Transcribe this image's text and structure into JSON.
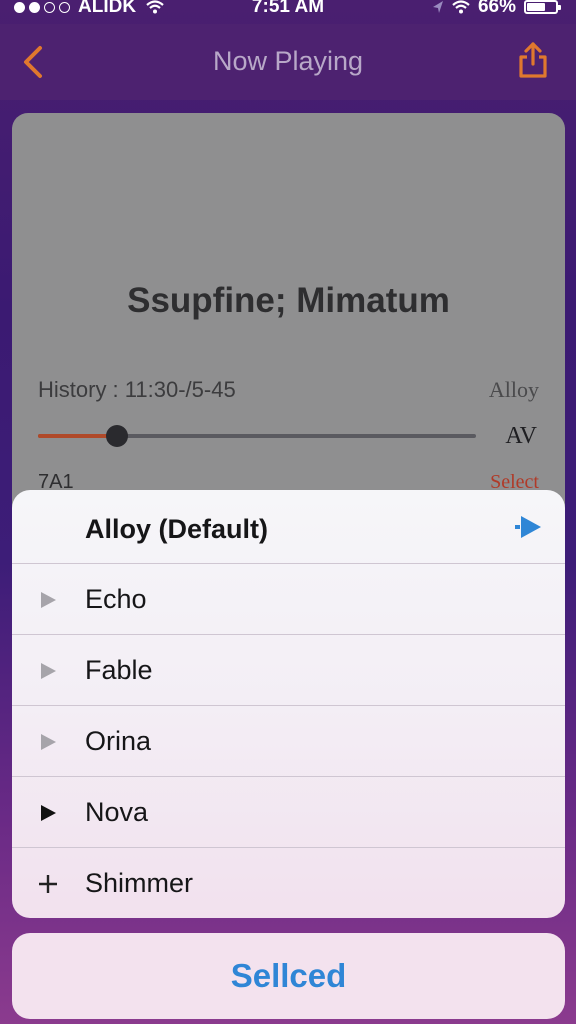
{
  "status_bar": {
    "carrier": "ALIDK",
    "time": "7:51 AM",
    "battery": "66%",
    "battery_level": 0.66,
    "icons": [
      "signal-dots-icon",
      "wifi-icon",
      "location-arrow-icon",
      "battery-icon"
    ]
  },
  "nav": {
    "title": "Now Playing",
    "back_icon": "chevron-left-icon",
    "share_icon": "share-icon",
    "accent": "#e0782e"
  },
  "card": {
    "title": "Ssupfine; Mimatum",
    "history": "History : 11:30-/5-45",
    "voice_label": "Alloy",
    "progress": 0.18,
    "av_label": "AV",
    "code_label": "7A1",
    "select_label": "Select"
  },
  "menu": {
    "options": [
      {
        "label": "Alloy (Default)",
        "marker": "none",
        "selected": true,
        "play_icon": "play-icon",
        "play_color": "#2f86d6"
      },
      {
        "label": "Echo",
        "marker": "triangle-light"
      },
      {
        "label": "Fable",
        "marker": "triangle-light"
      },
      {
        "label": "Orina",
        "marker": "triangle-light"
      },
      {
        "label": "Nova",
        "marker": "triangle-dark"
      },
      {
        "label": "Shimmer",
        "marker": "plus"
      }
    ]
  },
  "confirm_button": {
    "label": "Sellced",
    "color": "#2f86d6"
  }
}
